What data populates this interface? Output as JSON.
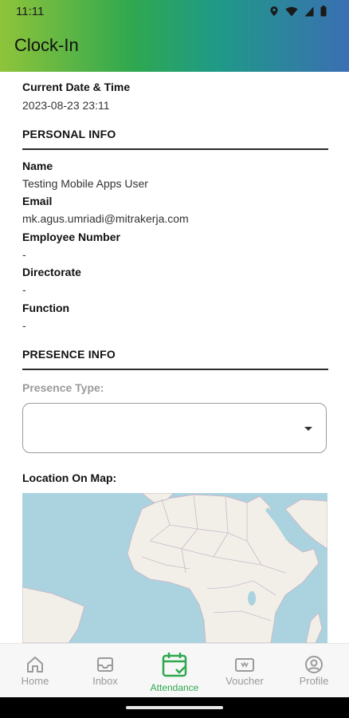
{
  "status_bar": {
    "time": "11:11"
  },
  "header": {
    "title": "Clock-In"
  },
  "datetime": {
    "label": "Current Date & Time",
    "value": "2023-08-23 23:11"
  },
  "personal_info": {
    "heading": "PERSONAL INFO",
    "fields": [
      {
        "label": "Name",
        "value": "Testing Mobile Apps User"
      },
      {
        "label": "Email",
        "value": "mk.agus.umriadi@mitrakerja.com"
      },
      {
        "label": "Employee Number",
        "value": "-"
      },
      {
        "label": "Directorate",
        "value": "-"
      },
      {
        "label": "Function",
        "value": "-"
      }
    ]
  },
  "presence_info": {
    "heading": "PRESENCE INFO",
    "presence_type_label": "Presence Type:",
    "presence_type_value": "",
    "location_label": "Location On Map:"
  },
  "bottom_nav": {
    "items": [
      {
        "label": "Home",
        "icon": "home-icon",
        "active": false
      },
      {
        "label": "Inbox",
        "icon": "inbox-icon",
        "active": false
      },
      {
        "label": "Attendance",
        "icon": "calendar-check-icon",
        "active": true
      },
      {
        "label": "Voucher",
        "icon": "voucher-icon",
        "active": false
      },
      {
        "label": "Profile",
        "icon": "profile-icon",
        "active": false
      }
    ]
  },
  "colors": {
    "accent": "#2fa84f",
    "inactive": "#9a9a9a",
    "map_water": "#aad3df",
    "map_land": "#f2efe9"
  }
}
